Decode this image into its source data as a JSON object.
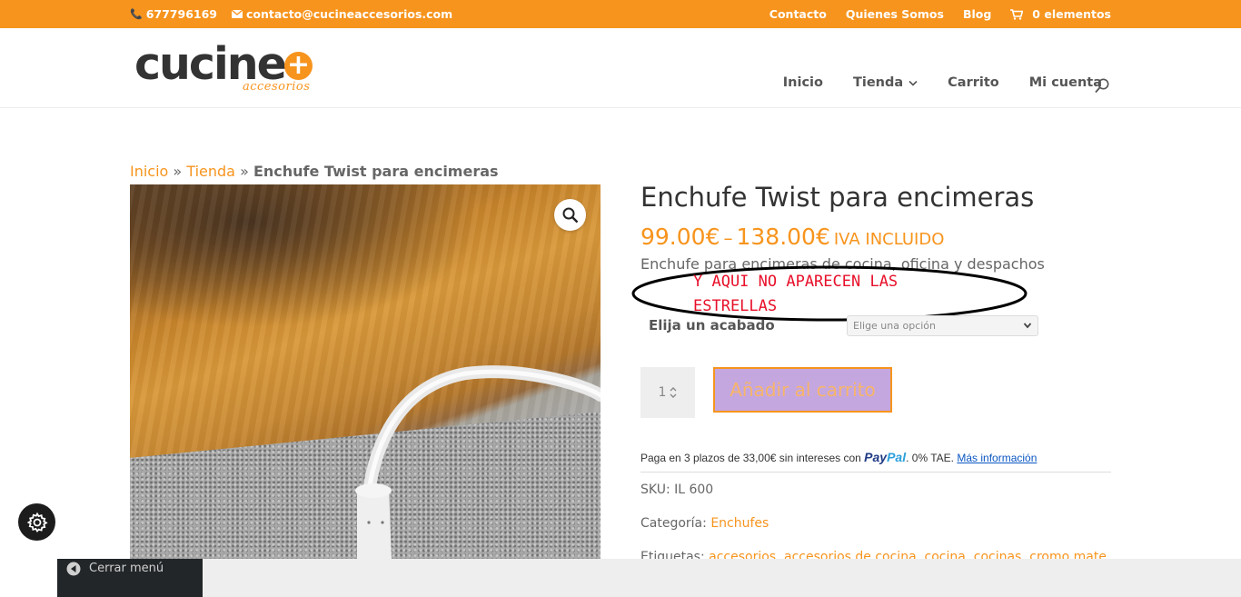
{
  "topbar": {
    "phone": "677796169",
    "email": "contacto@cucineaccesorios.com",
    "links": [
      "Contacto",
      "Quienes Somos",
      "Blog"
    ],
    "cart": "0 elementos"
  },
  "logo": {
    "word": "cucine",
    "plus": "+",
    "sub": "accesorios"
  },
  "nav": {
    "items": [
      "Inicio",
      "Tienda",
      "Carrito",
      "Mi cuenta"
    ]
  },
  "breadcrumb": {
    "home": "Inicio",
    "sep1": " » ",
    "shop": "Tienda",
    "sep2": " » ",
    "current": "Enchufe Twist para encimeras"
  },
  "product": {
    "title": "Enchufe Twist para encimeras",
    "price_min": "99.00€",
    "price_dash": "–",
    "price_max": "138.00€",
    "price_suffix": "IVA INCLUIDO",
    "short_desc": "Enchufe para encimeras de cocina, oficina y despachos",
    "annotation_line1": "Y AQUI NO APARECEN LAS",
    "annotation_line2": "ESTRELLAS",
    "variant_label": "Elija un acabado",
    "variant_placeholder": "Elige una opción",
    "quantity": "1",
    "add_to_cart": "Añadir al carrito",
    "paypal_pre": "Paga en 3 plazos de 33,00€ sin intereses con ",
    "paypal_brand1": "Pay",
    "paypal_brand2": "Pal",
    "paypal_post": ". 0% TAE. ",
    "paypal_more": "Más información",
    "sku_label": "SKU:",
    "sku_value": "IL 600",
    "category_label": "Categoría:",
    "category_value": "Enchufes",
    "tags_label": "Etiquetas:",
    "tags_value": "accesorios, accesorios de cocina, cocina, cocinas, cromo mate"
  },
  "footer": {
    "close_menu": "Cerrar menú"
  },
  "colors": {
    "accent": "#f7941d",
    "annotation": "#e8102a",
    "button_bg": "#c5a7df"
  },
  "icons": [
    "phone-icon",
    "mail-icon",
    "cart-icon",
    "search-icon",
    "chevron-down-icon",
    "zoom-icon",
    "gear-icon",
    "arrow-left-icon"
  ]
}
